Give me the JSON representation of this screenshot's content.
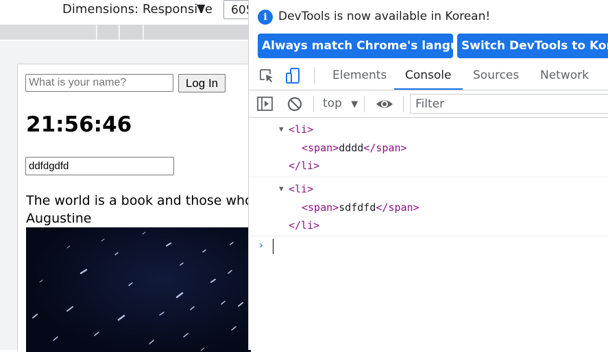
{
  "device_toolbar": {
    "dimensions_label": "Dimensions: Responsive",
    "dimensions_caret": "▼",
    "width_value": "605"
  },
  "page": {
    "name_placeholder": "What is your name?",
    "login_label": "Log In",
    "clock": "21:56:46",
    "todo_value": "ddfdgdfd",
    "quote_text": "The world is a book and those who",
    "quote_author": "Augustine"
  },
  "devtools": {
    "infobar": {
      "icon": "info-icon",
      "message": "DevTools is now available in Korean!",
      "match_button": "Always match Chrome's language",
      "switch_button": "Switch DevTools to Korean"
    },
    "tabs": [
      {
        "label": "Elements",
        "active": false
      },
      {
        "label": "Console",
        "active": true
      },
      {
        "label": "Sources",
        "active": false
      },
      {
        "label": "Network",
        "active": false
      }
    ],
    "console_toolbar": {
      "context": "top",
      "context_caret": "▼",
      "filter_placeholder": "Filter"
    },
    "console_entries": [
      {
        "open_tag": "<li>",
        "inner_open": "<span>",
        "inner_text": "dddd",
        "inner_close": "</span>",
        "close_tag": "</li>"
      },
      {
        "open_tag": "<li>",
        "inner_open": "<span>",
        "inner_text": "sdfdfd",
        "inner_close": "</span>",
        "close_tag": "</li>"
      }
    ],
    "prompt_symbol": "›"
  },
  "colors": {
    "accent": "#1a73e8",
    "tag": "#881280",
    "page_background_image": "#050818"
  }
}
